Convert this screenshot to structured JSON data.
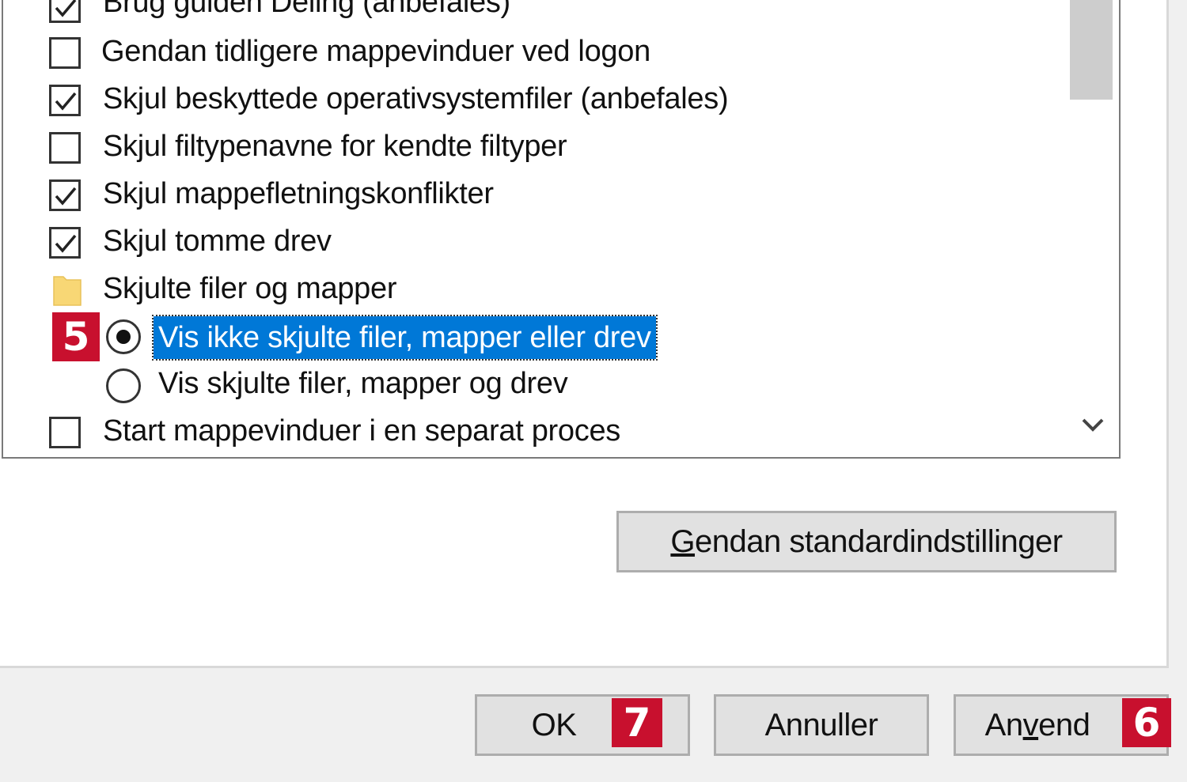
{
  "options": {
    "partial_top": "Brug guiden Deling (anbefales)",
    "restore_windows": "Gendan tidligere mappevinduer ved logon",
    "hide_system_files": "Skjul beskyttede operativsystemfiler (anbefales)",
    "hide_extensions": "Skjul filtypenavne for kendte filtyper",
    "hide_merge_conflicts": "Skjul mappefletningskonflikter",
    "hide_empty_drives": "Skjul tomme drev",
    "hidden_files_group": "Skjulte filer og mapper",
    "radio_dont_show": "Vis ikke skjulte filer, mapper eller drev",
    "radio_show": "Vis skjulte filer, mapper og drev",
    "separate_process": "Start mappevinduer i en separat proces"
  },
  "checked": {
    "partial_top": true,
    "restore_windows": false,
    "hide_system_files": true,
    "hide_extensions": false,
    "hide_merge_conflicts": true,
    "hide_empty_drives": true,
    "separate_process": false
  },
  "selected_radio": "radio_dont_show",
  "buttons": {
    "restore_defaults_prefix": "G",
    "restore_defaults_rest": "endan standardindstillinger",
    "ok": "OK",
    "cancel": "Annuller",
    "apply_a": "An",
    "apply_v": "v",
    "apply_rest": "end"
  },
  "badges": {
    "step5": "5",
    "step6": "6",
    "step7": "7"
  },
  "colors": {
    "selection": "#0078d7",
    "badge": "#c8102e",
    "folder": "#f8d775"
  }
}
